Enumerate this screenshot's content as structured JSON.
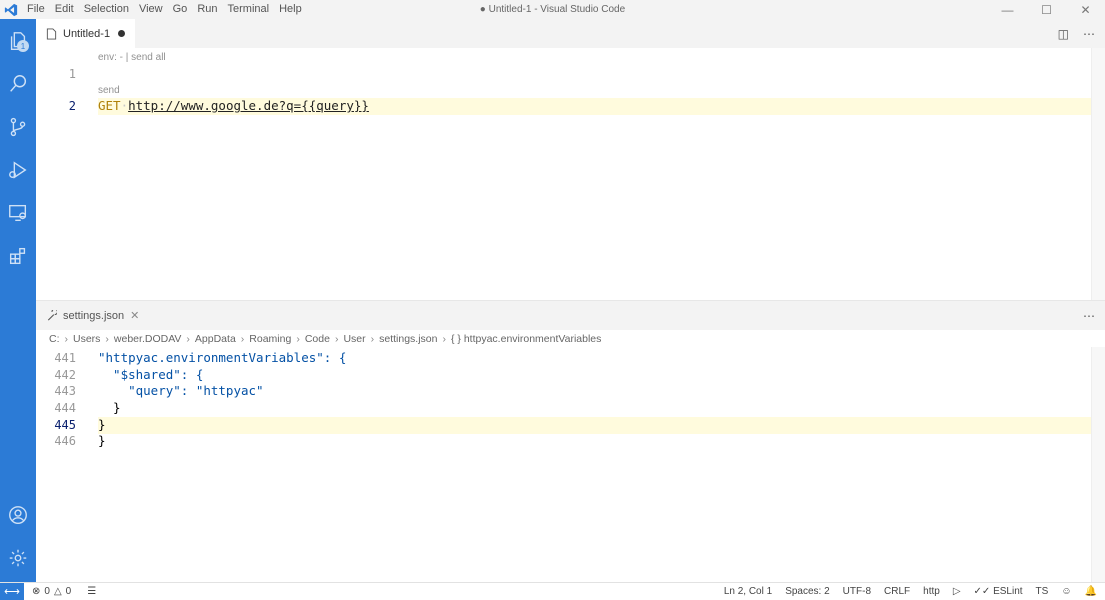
{
  "titlebar": {
    "menu": [
      "File",
      "Edit",
      "Selection",
      "View",
      "Go",
      "Run",
      "Terminal",
      "Help"
    ],
    "title": "● Untitled-1 - Visual Studio Code"
  },
  "activity": {
    "explorer_badge": "1",
    "icons": [
      "files-icon",
      "search-icon",
      "source-control-icon",
      "run-debug-icon",
      "remote-explorer-icon",
      "extensions-icon",
      "account-icon",
      "settings-gear-icon"
    ],
    "accent": "#2c7bd6"
  },
  "editor1": {
    "tab_label": "Untitled-1",
    "codelens1": "env: - | send all",
    "codelens2": "send",
    "line1": "1",
    "line2": "2",
    "method": "GET",
    "url": "http://www.google.de?q={{query}}"
  },
  "editor2": {
    "tab_label": "settings.json",
    "breadcrumb": [
      "C:",
      "Users",
      "weber.DODAV",
      "AppData",
      "Roaming",
      "Code",
      "User",
      "settings.json",
      "{ } httpyac.environmentVariables"
    ],
    "lines": [
      {
        "num": "441",
        "text": "\"httpyac.environmentVariables\": {"
      },
      {
        "num": "442",
        "text": "  \"$shared\": {"
      },
      {
        "num": "443",
        "text": "    \"query\": \"httpyac\""
      },
      {
        "num": "444",
        "text": "  }"
      },
      {
        "num": "445",
        "text": "}"
      },
      {
        "num": "446",
        "text": "}"
      }
    ]
  },
  "status": {
    "errors": "0",
    "warnings": "0",
    "position": "Ln 2, Col 1",
    "spaces": "Spaces: 2",
    "encoding": "UTF-8",
    "eol": "CRLF",
    "language": "http",
    "eslint": "ESLint",
    "ts": "TS"
  }
}
